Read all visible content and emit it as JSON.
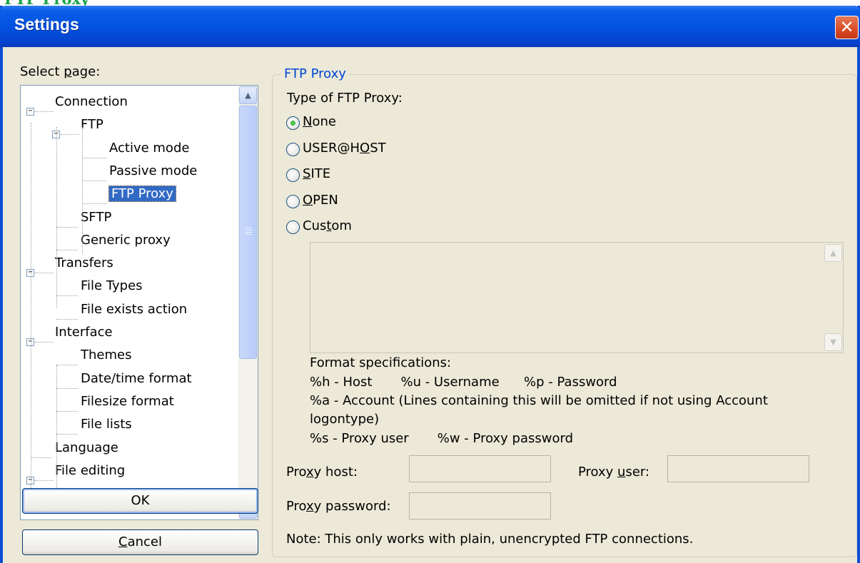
{
  "doc_heading": "FTP Proxy",
  "window": {
    "title": "Settings",
    "close_label": "✕"
  },
  "select_page_label": "Select page:",
  "tree": [
    {
      "label": "Connection",
      "level": 0,
      "expanded": true
    },
    {
      "label": "FTP",
      "level": 1,
      "expanded": true
    },
    {
      "label": "Active mode",
      "level": 2
    },
    {
      "label": "Passive mode",
      "level": 2
    },
    {
      "label": "FTP Proxy",
      "level": 2,
      "selected": true
    },
    {
      "label": "SFTP",
      "level": 1
    },
    {
      "label": "Generic proxy",
      "level": 1
    },
    {
      "label": "Transfers",
      "level": 0,
      "expanded": true
    },
    {
      "label": "File Types",
      "level": 1
    },
    {
      "label": "File exists action",
      "level": 1
    },
    {
      "label": "Interface",
      "level": 0,
      "expanded": true
    },
    {
      "label": "Themes",
      "level": 1
    },
    {
      "label": "Date/time format",
      "level": 1
    },
    {
      "label": "Filesize format",
      "level": 1
    },
    {
      "label": "File lists",
      "level": 1
    },
    {
      "label": "Language",
      "level": 0
    },
    {
      "label": "File editing",
      "level": 0,
      "expanded": true
    }
  ],
  "buttons": {
    "ok": "OK",
    "cancel": "Cancel"
  },
  "group": {
    "title": "FTP Proxy",
    "type_label": "Type of FTP Proxy:",
    "radios": [
      {
        "label": "None",
        "checked": true
      },
      {
        "label": "USER@HOST",
        "checked": false
      },
      {
        "label": "SITE",
        "checked": false
      },
      {
        "label": "OPEN",
        "checked": false
      },
      {
        "label": "Custom",
        "checked": false
      }
    ],
    "custom_text": "",
    "format_lines": [
      "Format specifications:",
      "%h - Host       %u - Username      %p - Password",
      "%a - Account (Lines containing this will be omitted if not using Account",
      "logontype)",
      "%s - Proxy user       %w - Proxy password"
    ],
    "proxy_host_label": "Proxy host:",
    "proxy_host_value": "",
    "proxy_user_label": "Proxy user:",
    "proxy_user_value": "",
    "proxy_password_label": "Proxy password:",
    "proxy_password_value": "",
    "note": "Note: This only works with plain, unencrypted FTP connections."
  },
  "icons": {
    "expander": "minus-box-icon",
    "scroll_up": "chevron-up-icon",
    "scroll_down": "chevron-down-icon",
    "close": "close-icon"
  }
}
